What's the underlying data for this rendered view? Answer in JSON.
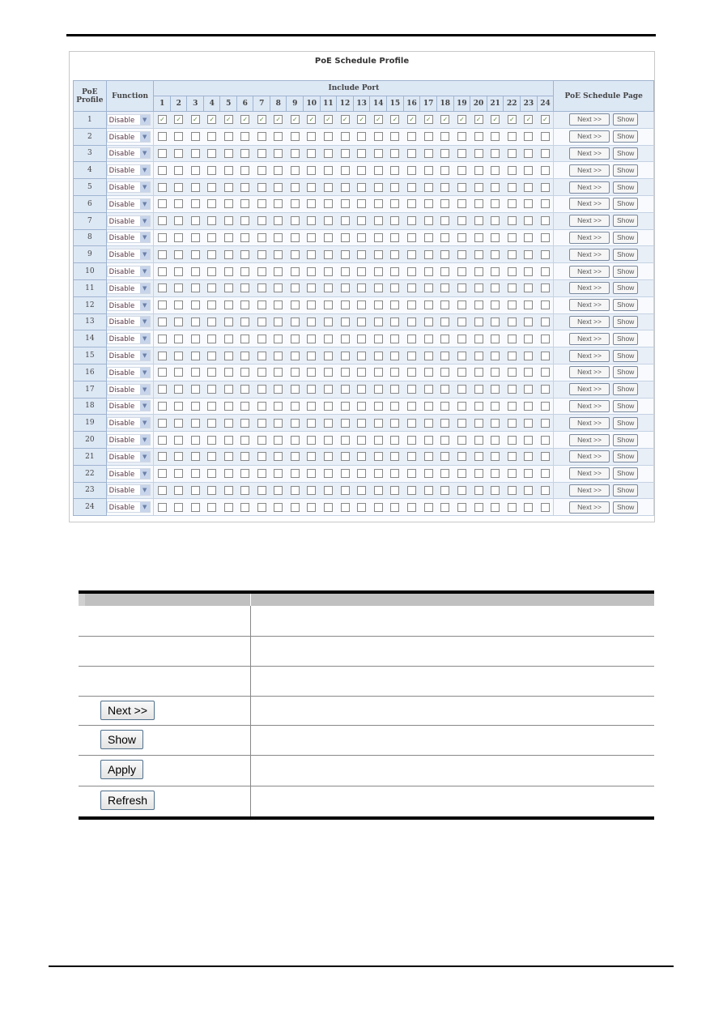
{
  "panel": {
    "title": "PoE Schedule Profile",
    "headers": {
      "profile": "PoE Profile",
      "function": "Function",
      "include_port": "Include Port",
      "schedule_page": "PoE Schedule Page"
    },
    "ports": [
      "1",
      "2",
      "3",
      "4",
      "5",
      "6",
      "7",
      "8",
      "9",
      "10",
      "11",
      "12",
      "13",
      "14",
      "15",
      "16",
      "17",
      "18",
      "19",
      "20",
      "21",
      "22",
      "23",
      "24"
    ],
    "next_label": "Next >>",
    "show_label": "Show",
    "profiles": [
      {
        "id": "1",
        "function": "Disable",
        "checked_ports": [
          1,
          2,
          3,
          4,
          5,
          6,
          7,
          8,
          9,
          10,
          11,
          12,
          13,
          14,
          15,
          16,
          17,
          18,
          19,
          20,
          21,
          22,
          23,
          24
        ]
      },
      {
        "id": "2",
        "function": "Disable",
        "checked_ports": []
      },
      {
        "id": "3",
        "function": "Disable",
        "checked_ports": []
      },
      {
        "id": "4",
        "function": "Disable",
        "checked_ports": []
      },
      {
        "id": "5",
        "function": "Disable",
        "checked_ports": []
      },
      {
        "id": "6",
        "function": "Disable",
        "checked_ports": []
      },
      {
        "id": "7",
        "function": "Disable",
        "checked_ports": []
      },
      {
        "id": "8",
        "function": "Disable",
        "checked_ports": []
      },
      {
        "id": "9",
        "function": "Disable",
        "checked_ports": []
      },
      {
        "id": "10",
        "function": "Disable",
        "checked_ports": []
      },
      {
        "id": "11",
        "function": "Disable",
        "checked_ports": []
      },
      {
        "id": "12",
        "function": "Disable",
        "checked_ports": []
      },
      {
        "id": "13",
        "function": "Disable",
        "checked_ports": []
      },
      {
        "id": "14",
        "function": "Disable",
        "checked_ports": []
      },
      {
        "id": "15",
        "function": "Disable",
        "checked_ports": []
      },
      {
        "id": "16",
        "function": "Disable",
        "checked_ports": []
      },
      {
        "id": "17",
        "function": "Disable",
        "checked_ports": []
      },
      {
        "id": "18",
        "function": "Disable",
        "checked_ports": []
      },
      {
        "id": "19",
        "function": "Disable",
        "checked_ports": []
      },
      {
        "id": "20",
        "function": "Disable",
        "checked_ports": []
      },
      {
        "id": "21",
        "function": "Disable",
        "checked_ports": []
      },
      {
        "id": "22",
        "function": "Disable",
        "checked_ports": []
      },
      {
        "id": "23",
        "function": "Disable",
        "checked_ports": []
      },
      {
        "id": "24",
        "function": "Disable",
        "checked_ports": []
      }
    ]
  },
  "description_table": {
    "buttons": [
      "Next >>",
      "Show",
      "Apply",
      "Refresh"
    ]
  },
  "colors": {
    "header_bg": "#dde8f5",
    "row_odd": "#e9eff7",
    "check": "#5a8a40"
  }
}
